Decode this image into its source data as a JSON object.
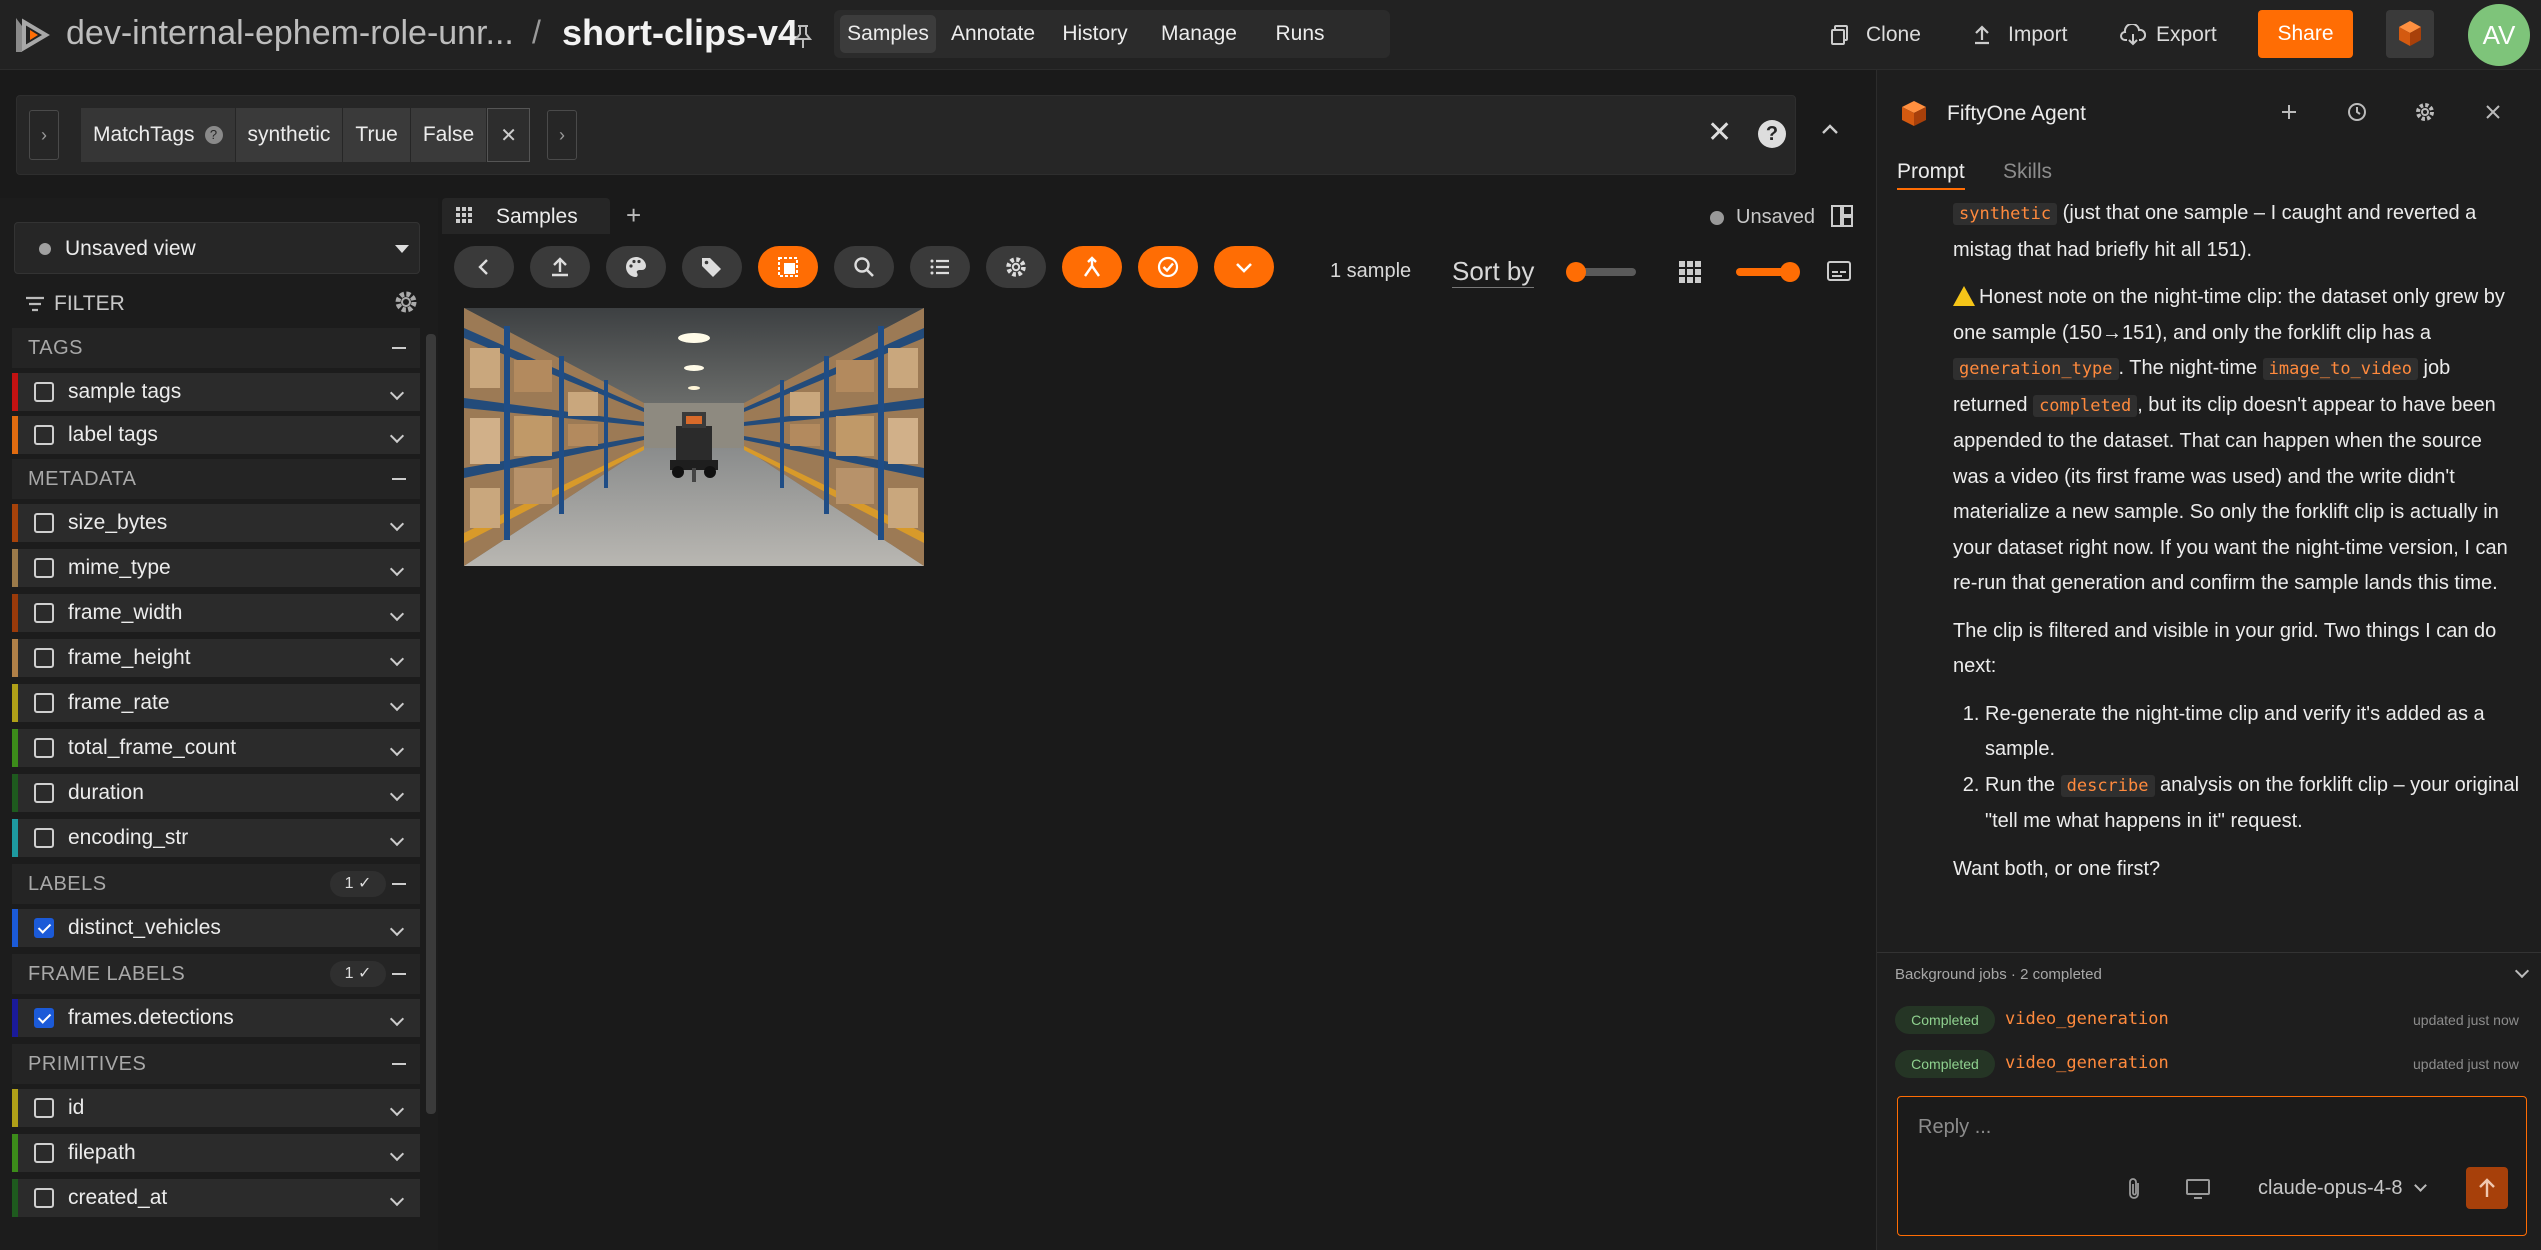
{
  "topbar": {
    "dataset_name": "dev-internal-ephem-role-unr...",
    "separator": "/",
    "view_name": "short-clips-v4",
    "nav": [
      {
        "label": "Samples",
        "active": true
      },
      {
        "label": "Annotate",
        "active": false
      },
      {
        "label": "History",
        "active": false
      },
      {
        "label": "Manage",
        "active": false
      },
      {
        "label": "Runs",
        "active": false
      }
    ],
    "clone_label": "Clone",
    "import_label": "Import",
    "export_label": "Export",
    "share_label": "Share",
    "avatar_initials": "AV",
    "accent_color": "#ff6d04"
  },
  "viewbar": {
    "stage_name": "MatchTags",
    "help_mark": "?",
    "stage_params": [
      "synthetic",
      "True",
      "False"
    ],
    "stage_close": "✕",
    "clear": "✕",
    "help": "?"
  },
  "sidebar": {
    "view_select": "Unsaved view",
    "filter_label": "FILTER",
    "sections": [
      {
        "title": "TAGS",
        "count": "",
        "fields": [
          {
            "name": "sample tags",
            "color": "#c31212",
            "checked": false
          },
          {
            "name": "label tags",
            "color": "#e06b10",
            "checked": false
          }
        ]
      },
      {
        "title": "METADATA",
        "count": "",
        "fields": [
          {
            "name": "size_bytes",
            "color": "#a6420a",
            "checked": false
          },
          {
            "name": "mime_type",
            "color": "#9b7a4a",
            "checked": false
          },
          {
            "name": "frame_width",
            "color": "#9a3a0a",
            "checked": false
          },
          {
            "name": "frame_height",
            "color": "#b08048",
            "checked": false
          },
          {
            "name": "frame_rate",
            "color": "#b0a018",
            "checked": false
          },
          {
            "name": "total_frame_count",
            "color": "#3c8c1a",
            "checked": false
          },
          {
            "name": "duration",
            "color": "#1e5a1e",
            "checked": false
          },
          {
            "name": "encoding_str",
            "color": "#1e9aa0",
            "checked": false
          }
        ]
      },
      {
        "title": "LABELS",
        "count": "1 ✓",
        "fields": [
          {
            "name": "distinct_vehicles",
            "color": "#1b5ad8",
            "checked": true
          }
        ]
      },
      {
        "title": "FRAME LABELS",
        "count": "1 ✓",
        "fields": [
          {
            "name": "frames.detections",
            "color": "#1a1a9a",
            "checked": true
          }
        ]
      },
      {
        "title": "PRIMITIVES",
        "count": "",
        "fields": [
          {
            "name": "id",
            "color": "#b0a018",
            "checked": false
          },
          {
            "name": "filepath",
            "color": "#3c8c1a",
            "checked": false
          },
          {
            "name": "created_at",
            "color": "#1e5a1e",
            "checked": false
          }
        ]
      }
    ]
  },
  "grid": {
    "tab_label": "Samples",
    "unsaved_label": "Unsaved",
    "sample_count": "1 sample",
    "sort_by": "Sort by"
  },
  "agent": {
    "title": "FiftyOne Agent",
    "tabs": [
      {
        "label": "Prompt",
        "active": true
      },
      {
        "label": "Skills",
        "active": false
      }
    ],
    "background_jobs": "Background jobs · 2 completed",
    "jobs": [
      {
        "status": "Completed",
        "name": "video_generation",
        "time": "updated just now"
      },
      {
        "status": "Completed",
        "name": "video_generation",
        "time": "updated just now"
      }
    ],
    "reply_placeholder": "Reply ...",
    "model": "claude-opus-4-8"
  },
  "message": {
    "p1_code": "synthetic",
    "p1_text": " (just that one sample – I caught and reverted a mistag that had briefly hit all 151).",
    "p2_a": "Honest note on the night-time clip: the dataset only grew by one sample (150→151), and only the forklift clip has a ",
    "p2_code1": "generation_type",
    "p2_b": ". The night-time ",
    "p2_code2": "image_to_video",
    "p2_c": " job returned ",
    "p2_code3": "completed",
    "p2_d": ", but its clip doesn't appear to have been appended to the dataset. That can happen when the source was a video (its first frame was used) and the write didn't materialize a new sample. So only the forklift clip is actually in your dataset right now. If you want the night-time version, I can re-run that generation and confirm the sample lands this time.",
    "p3": "The clip is filtered and visible in your grid. Two things I can do next:",
    "li1": "Re-generate the night-time clip and verify it's added as a sample.",
    "li2_a": "Run the ",
    "li2_code": "describe",
    "li2_b": " analysis on the forklift clip – your original \"tell me what happens in it\" request.",
    "p4": "Want both, or one first?"
  }
}
